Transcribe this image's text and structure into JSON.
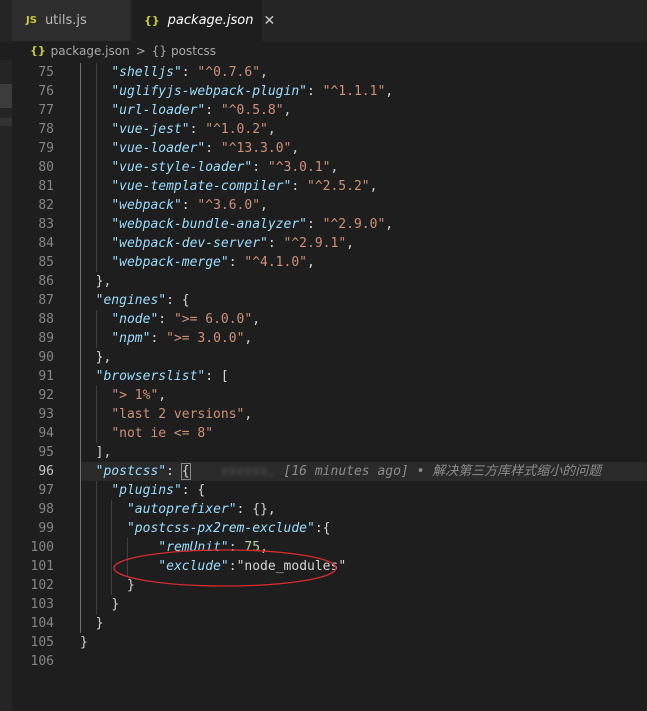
{
  "tabs": [
    {
      "icon": "JS",
      "label": "utils.js"
    },
    {
      "icon": "{}",
      "label": "package.json",
      "close": "✕"
    }
  ],
  "breadcrumb": {
    "file": "package.json",
    "node": "postcss",
    "obj_icon": "{}",
    "sep": ">"
  },
  "lines": [
    {
      "n": "75",
      "key": "shelljs",
      "val": "^0.7.6"
    },
    {
      "n": "76",
      "key": "uglifyjs-webpack-plugin",
      "val": "^1.1.1"
    },
    {
      "n": "77",
      "key": "url-loader",
      "val": "^0.5.8"
    },
    {
      "n": "78",
      "key": "vue-jest",
      "val": "^1.0.2"
    },
    {
      "n": "79",
      "key": "vue-loader",
      "val": "^13.3.0"
    },
    {
      "n": "80",
      "key": "vue-style-loader",
      "val": "^3.0.1"
    },
    {
      "n": "81",
      "key": "vue-template-compiler",
      "val": "^2.5.2"
    },
    {
      "n": "82",
      "key": "webpack",
      "val": "^3.6.0"
    },
    {
      "n": "83",
      "key": "webpack-bundle-analyzer",
      "val": "^2.9.0"
    },
    {
      "n": "84",
      "key": "webpack-dev-server",
      "val": "^2.9.1"
    },
    {
      "n": "85",
      "key": "webpack-merge",
      "val": "^4.1.0"
    },
    {
      "n": "86",
      "text": "},"
    },
    {
      "n": "87",
      "key": "engines",
      "open": ": {"
    },
    {
      "n": "88",
      "key": "node",
      "val": ">= 6.0.0"
    },
    {
      "n": "89",
      "key": "npm",
      "val": ">= 3.0.0"
    },
    {
      "n": "90",
      "text": "},"
    },
    {
      "n": "91",
      "key": "browserslist",
      "open": ": ["
    },
    {
      "n": "92",
      "str": "> 1%"
    },
    {
      "n": "93",
      "str": "last 2 versions"
    },
    {
      "n": "94",
      "str": "not ie <= 8"
    },
    {
      "n": "95",
      "text": "],"
    },
    {
      "n": "96",
      "key": "postcss",
      "blame_author": "xxxxxx, ",
      "blame_text": "[16 minutes ago] • 解决第三方库样式缩小的问题"
    },
    {
      "n": "97",
      "key": "plugins",
      "open": ": {"
    },
    {
      "n": "98",
      "key": "autoprefixer",
      "open": ": {},"
    },
    {
      "n": "99",
      "key": "postcss-px2rem-exclude",
      "open": ":{"
    },
    {
      "n": "100",
      "key": "remUnit",
      "num": "75"
    },
    {
      "n": "101",
      "key": "exclude",
      "val": "node_modules"
    },
    {
      "n": "102",
      "text": "}"
    },
    {
      "n": "103",
      "text": "}"
    },
    {
      "n": "104",
      "text": "}"
    },
    {
      "n": "105",
      "text": "}"
    },
    {
      "n": "106",
      "text": ""
    }
  ],
  "colors": {
    "annotation": "#d12d2d",
    "key": "#9cdcfe",
    "string": "#ce9178",
    "number": "#b5cea8"
  }
}
